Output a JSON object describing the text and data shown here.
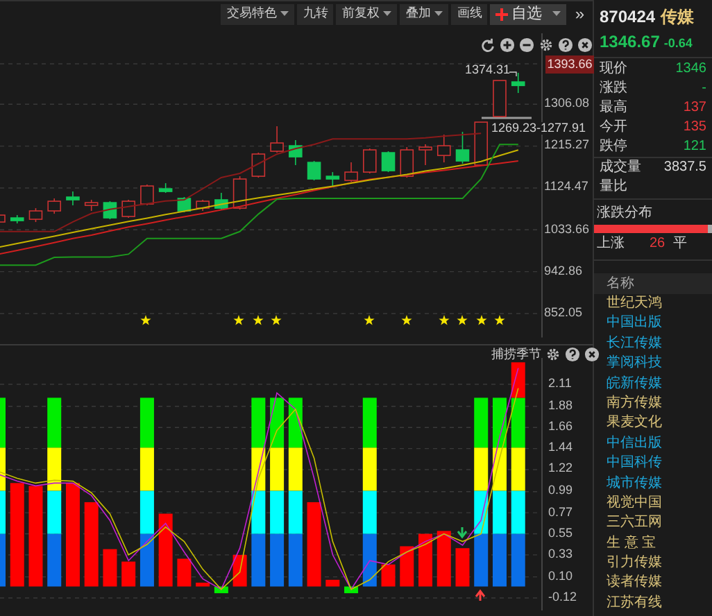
{
  "toolbar": [
    {
      "label": "交易特色",
      "kind": "dropdown"
    },
    {
      "label": "九转",
      "kind": "plain"
    },
    {
      "label": "前复权",
      "kind": "dropdown"
    },
    {
      "label": "叠加",
      "kind": "dropdown"
    },
    {
      "label": "画线",
      "kind": "plain"
    },
    {
      "label": "自选",
      "kind": "add"
    },
    {
      "label": "»",
      "kind": "more"
    }
  ],
  "price_chart": {
    "current_price_tag": "1393.66",
    "high_label": "1374.31",
    "range_label": "1269.23-1277.91",
    "chart_data": {
      "type": "candlestick",
      "grid": true,
      "ylim": [
        800,
        1460
      ],
      "yticks": [
        {
          "value": 1306.08,
          "label": "1306.08"
        },
        {
          "value": 1215.27,
          "label": "1215.27"
        },
        {
          "value": 1124.47,
          "label": "1124.47"
        },
        {
          "value": 1033.66,
          "label": "1033.66"
        },
        {
          "value": 942.86,
          "label": "942.86"
        },
        {
          "value": 852.05,
          "label": "852.05"
        }
      ],
      "ohlc": [
        [
          1050.6,
          1071.7,
          1044.6,
          1065.6
        ],
        [
          1059.6,
          1065.6,
          1047.6,
          1053.6
        ],
        [
          1056.6,
          1080.7,
          1050.6,
          1074.7
        ],
        [
          1074.7,
          1101.8,
          1068.6,
          1095.7
        ],
        [
          1104.8,
          1116.8,
          1086.7,
          1098.8
        ],
        [
          1086.7,
          1098.8,
          1074.7,
          1092.7
        ],
        [
          1092.7,
          1095.7,
          1056.6,
          1059.6
        ],
        [
          1062.6,
          1098.8,
          1059.6,
          1095.7
        ],
        [
          1089.7,
          1131.9,
          1086.7,
          1128.8
        ],
        [
          1122.8,
          1134.9,
          1113.8,
          1116.8
        ],
        [
          1101.8,
          1104.8,
          1071.7,
          1074.7
        ],
        [
          1080.7,
          1098.8,
          1074.7,
          1095.7
        ],
        [
          1098.8,
          1113.8,
          1077.7,
          1080.7
        ],
        [
          1080.7,
          1149.9,
          1077.7,
          1143.9
        ],
        [
          1149.9,
          1201.1,
          1146.9,
          1198.1
        ],
        [
          1204.1,
          1258.3,
          1201.1,
          1222.1
        ],
        [
          1216.1,
          1228.2,
          1174.0,
          1192.0
        ],
        [
          1180.0,
          1183.0,
          1140.9,
          1143.9
        ],
        [
          1149.9,
          1158.9,
          1128.8,
          1143.9
        ],
        [
          1140.9,
          1180.0,
          1137.9,
          1158.9
        ],
        [
          1158.9,
          1210.1,
          1155.9,
          1207.1
        ],
        [
          1201.1,
          1204.1,
          1158.9,
          1161.9
        ],
        [
          1149.9,
          1213.1,
          1146.9,
          1207.1
        ],
        [
          1207.1,
          1219.1,
          1174.0,
          1213.1
        ],
        [
          1195.0,
          1240.2,
          1180.0,
          1216.1
        ],
        [
          1207.1,
          1246.2,
          1177.0,
          1183.0
        ],
        [
          1174.0,
          1267.3,
          1174.0,
          1267.3
        ],
        [
          1279.3,
          1357.6,
          1279.3,
          1357.6
        ],
        [
          1354.6,
          1374.31,
          1330.5,
          1346.67
        ]
      ],
      "series": [
        {
          "type": "line",
          "color": "#8a1a1a",
          "values": [
            1030,
            1030,
            1030,
            1030,
            1051,
            1069,
            1078,
            1084,
            1090,
            1096,
            1099,
            1123,
            1147,
            1156,
            1177,
            1198,
            1210,
            1219,
            1231,
            1231,
            1231,
            1231,
            1231,
            1233,
            1237,
            1240,
            1243,
            null,
            null
          ]
        },
        {
          "type": "line",
          "color": "#d01f1f",
          "values": [
            981,
            989,
            997,
            1006,
            1015,
            1022,
            1031,
            1040,
            1047,
            1055,
            1062,
            1069,
            1077,
            1084,
            1093,
            1102,
            1110,
            1119,
            1127,
            1136,
            1143,
            1148,
            1153,
            1158,
            1163,
            1168,
            1173,
            1178,
            1183
          ]
        },
        {
          "type": "line",
          "color": "#c8b400",
          "values": [
            996,
            1004,
            1012,
            1020,
            1028,
            1036,
            1044,
            1052,
            1059,
            1067,
            1074,
            1081,
            1089,
            1096,
            1103,
            1109,
            1115,
            1122,
            1128,
            1135,
            1142,
            1148,
            1154,
            1161,
            1167,
            1174,
            1182,
            1195,
            1207
          ]
        },
        {
          "type": "line",
          "color": "#1d9a1d",
          "values": [
            957,
            957,
            957,
            974,
            975,
            975,
            975,
            981,
            1015,
            1015,
            1015,
            1015,
            1015,
            1030,
            1068,
            1100,
            1102,
            1102,
            1102,
            1102,
            1102,
            1102,
            1102,
            1102,
            1102,
            1102,
            1144,
            1219,
            1219
          ]
        }
      ]
    }
  },
  "indicator": {
    "title": "捕捞季节",
    "chart_data": {
      "type": "bar",
      "stacked": true,
      "grid": true,
      "ylim": [
        -0.25,
        2.4
      ],
      "yticks": [
        {
          "value": 2.11,
          "label": "2.11"
        },
        {
          "value": 1.88,
          "label": "1.88"
        },
        {
          "value": 1.66,
          "label": "1.66"
        },
        {
          "value": 1.44,
          "label": "1.44"
        },
        {
          "value": 1.22,
          "label": "1.22"
        },
        {
          "value": 0.99,
          "label": "0.99"
        },
        {
          "value": 0.77,
          "label": "0.77"
        },
        {
          "value": 0.55,
          "label": "0.55"
        },
        {
          "value": 0.33,
          "label": "0.33"
        },
        {
          "value": 0.1,
          "label": "0.10"
        },
        {
          "value": -0.12,
          "label": "-0.12"
        }
      ],
      "series": [
        {
          "type": "bar",
          "color": "#0a6fe8",
          "values": [
            0.55,
            null,
            null,
            0.55,
            null,
            null,
            null,
            null,
            0.55,
            null,
            null,
            null,
            null,
            null,
            0.55,
            0.55,
            0.55,
            null,
            null,
            null,
            0.55,
            null,
            null,
            null,
            null,
            null,
            0.55,
            0.55,
            0.55
          ]
        },
        {
          "type": "bar",
          "color": "#00ffff",
          "values": [
            0.45,
            null,
            null,
            0.45,
            null,
            null,
            null,
            null,
            0.45,
            null,
            null,
            null,
            null,
            null,
            0.45,
            0.45,
            0.45,
            null,
            null,
            null,
            0.45,
            null,
            null,
            null,
            null,
            null,
            0.45,
            0.45,
            0.45
          ]
        },
        {
          "type": "bar",
          "color": "#ffff00",
          "values": [
            0.45,
            null,
            null,
            0.45,
            null,
            null,
            null,
            null,
            0.45,
            null,
            null,
            null,
            null,
            null,
            0.45,
            0.45,
            0.45,
            null,
            null,
            null,
            0.45,
            null,
            null,
            null,
            null,
            null,
            0.45,
            0.45,
            0.45
          ]
        },
        {
          "type": "bar",
          "color": "#00ee00",
          "values": [
            0.52,
            null,
            null,
            0.52,
            null,
            null,
            null,
            null,
            0.52,
            null,
            null,
            null,
            -0.07,
            null,
            0.52,
            0.52,
            0.52,
            null,
            null,
            -0.07,
            0.52,
            null,
            null,
            null,
            null,
            null,
            0.52,
            0.52,
            0.52
          ]
        },
        {
          "type": "bar",
          "color": "#ff0000",
          "values": [
            null,
            1.08,
            1.05,
            null,
            1.08,
            0.88,
            0.39,
            0.26,
            null,
            0.76,
            0.29,
            0.04,
            null,
            0.33,
            null,
            null,
            null,
            0.88,
            0.07,
            null,
            null,
            0.23,
            0.42,
            0.55,
            0.58,
            0.4,
            null,
            null,
            0.37
          ]
        },
        {
          "type": "line",
          "color": "#c020d0",
          "values": [
            1.17,
            1.1,
            1.05,
            1.08,
            1.08,
            0.95,
            0.69,
            0.27,
            0.47,
            0.66,
            0.36,
            0.08,
            -0.03,
            0.4,
            1.2,
            2.02,
            1.85,
            1.13,
            0.33,
            -0.03,
            0.27,
            0.23,
            0.36,
            0.47,
            0.55,
            0.43,
            0.69,
            1.56,
            2.28
          ]
        },
        {
          "type": "line",
          "color": "#c8c000",
          "values": [
            1.2,
            1.13,
            1.08,
            1.11,
            1.1,
            0.98,
            0.76,
            0.33,
            0.44,
            0.62,
            0.47,
            0.18,
            -0.03,
            0.15,
            1.13,
            1.63,
            1.85,
            1.34,
            0.47,
            -0.03,
            0.07,
            0.26,
            0.36,
            0.44,
            0.55,
            0.47,
            0.55,
            1.34,
            2.07
          ]
        }
      ]
    }
  },
  "quote": {
    "code": "870424",
    "name": "传媒",
    "price": "1346.67",
    "change": "-0.64",
    "fields": [
      {
        "label": "现价",
        "value": "1346",
        "color": "#20c45a"
      },
      {
        "label": "涨跌",
        "value": "-",
        "color": "#20c45a"
      },
      {
        "label": "最高",
        "value": "137",
        "color": "#e8383c"
      },
      {
        "label": "今开",
        "value": "135",
        "color": "#e8383c"
      },
      {
        "label": "跌停",
        "value": "121",
        "color": "#20c45a"
      },
      {
        "label": "成交量",
        "value": "3837.5",
        "color": "#d8d8d8"
      },
      {
        "label": "量比"
      }
    ]
  },
  "distribution": {
    "title": "涨跌分布",
    "level": 0.97,
    "up_label": "上涨",
    "up_count": "26",
    "flat_label": "平"
  },
  "table": {
    "header": "名称",
    "rows": [
      {
        "name": "世纪天鸿",
        "color": "#d9c27a"
      },
      {
        "name": "中国出版",
        "color": "#1ea8dc"
      },
      {
        "name": "长江传媒",
        "color": "#1ea8dc"
      },
      {
        "name": "掌阅科技",
        "color": "#1ea8dc"
      },
      {
        "name": "皖新传媒",
        "color": "#1ea8dc"
      },
      {
        "name": "南方传媒",
        "color": "#d9c27a"
      },
      {
        "name": "果麦文化",
        "color": "#d9c27a"
      },
      {
        "name": "中信出版",
        "color": "#1ea8dc"
      },
      {
        "name": "中国科传",
        "color": "#1ea8dc"
      },
      {
        "name": "城市传媒",
        "color": "#1ea8dc"
      },
      {
        "name": "视觉中国",
        "color": "#d9c27a"
      },
      {
        "name": "三六五网",
        "color": "#d9c27a"
      },
      {
        "name": "生 意 宝",
        "color": "#d9c27a"
      },
      {
        "name": "引力传媒",
        "color": "#d9c27a"
      },
      {
        "name": "读者传媒",
        "color": "#d9c27a"
      },
      {
        "name": "江苏有线",
        "color": "#d9c27a"
      }
    ]
  }
}
